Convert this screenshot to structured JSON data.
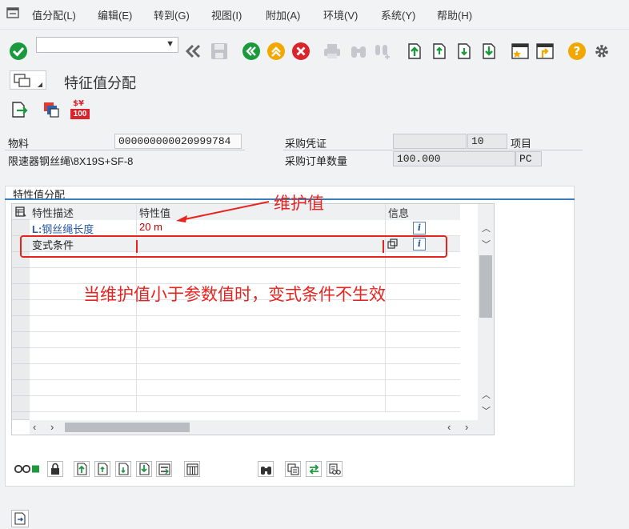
{
  "menu": {
    "items": [
      "值分配(L)",
      "编辑(E)",
      "转到(G)",
      "视图(I)",
      "附加(A)",
      "环境(V)",
      "系统(Y)",
      "帮助(H)"
    ]
  },
  "toolbar": {
    "command_value": "",
    "icons": [
      "check-icon",
      "back-double-icon",
      "save-icon",
      "back-green-icon",
      "exit-yellow-icon",
      "cancel-red-icon",
      "print-icon",
      "find-icon",
      "find-next-icon",
      "first-page-icon",
      "prev-page-icon",
      "next-page-icon",
      "last-page-icon",
      "new-session-icon",
      "shortcut-icon",
      "help-icon",
      "settings-icon"
    ],
    "colors": {
      "green": "#1a9a3c",
      "yellow": "#f2a800",
      "red": "#d9242b"
    }
  },
  "title": "特征值分配",
  "app_toolbar": {
    "icons": [
      "export-icon",
      "copy-values-icon",
      "price-icon"
    ],
    "price_badge": "100"
  },
  "header": {
    "material_label": "物料",
    "material_value": "000000000020999784",
    "material_desc": "限速器钢丝绳\\8X19S+SF-8",
    "po_label": "采购凭证",
    "po_value": "",
    "item_value": "10",
    "item_label": "项目",
    "qty_label": "采购订单数量",
    "qty_value": "100.000",
    "unit_value": "PC"
  },
  "group": {
    "title": "特性值分配",
    "columns": [
      "特性描述",
      "特性值",
      "信息"
    ],
    "rows": [
      {
        "desc_prefix": "L:",
        "desc": "钢丝绳长度",
        "value": "20 m"
      },
      {
        "desc_prefix": "",
        "desc": "变式条件",
        "value": ""
      }
    ]
  },
  "annotations": {
    "maintain_value": "维护值",
    "note": "当维护值小于参数值时，变式条件不生效"
  },
  "bottom_toolbar": {
    "icons": [
      "status-icon",
      "lock-icon",
      "first-icon",
      "prev-icon",
      "next-icon",
      "last-icon",
      "transfer-icon",
      "table-icon",
      "binoculars-icon",
      "copy-icon",
      "swap-icon",
      "search-list-icon"
    ]
  },
  "footer": {
    "icons": [
      "footer-page-icon"
    ]
  }
}
